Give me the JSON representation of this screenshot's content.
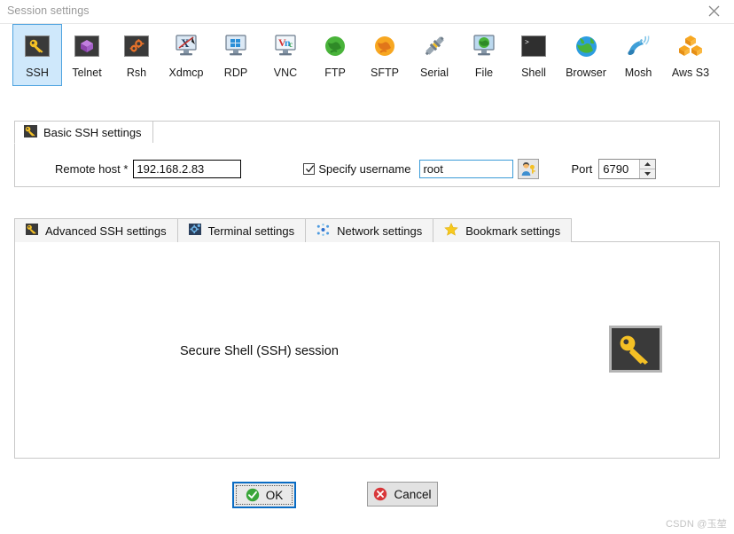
{
  "window": {
    "title": "Session settings",
    "close_icon": "close-icon"
  },
  "protocols": [
    {
      "label": "SSH",
      "icon": "ssh-key-icon",
      "selected": true
    },
    {
      "label": "Telnet",
      "icon": "telnet-cube-icon",
      "selected": false
    },
    {
      "label": "Rsh",
      "icon": "rsh-gears-icon",
      "selected": false
    },
    {
      "label": "Xdmcp",
      "icon": "xdmcp-x-monitor-icon",
      "selected": false
    },
    {
      "label": "RDP",
      "icon": "rdp-windows-monitor-icon",
      "selected": false
    },
    {
      "label": "VNC",
      "icon": "vnc-monitor-icon",
      "selected": false
    },
    {
      "label": "FTP",
      "icon": "ftp-green-globe-icon",
      "selected": false
    },
    {
      "label": "SFTP",
      "icon": "sftp-orange-globe-icon",
      "selected": false
    },
    {
      "label": "Serial",
      "icon": "serial-plug-icon",
      "selected": false
    },
    {
      "label": "File",
      "icon": "file-globe-monitor-icon",
      "selected": false
    },
    {
      "label": "Shell",
      "icon": "shell-prompt-icon",
      "selected": false
    },
    {
      "label": "Browser",
      "icon": "browser-globe-icon",
      "selected": false
    },
    {
      "label": "Mosh",
      "icon": "mosh-satellite-icon",
      "selected": false
    },
    {
      "label": "Aws S3",
      "icon": "aws-s3-cubes-icon",
      "selected": false
    }
  ],
  "basic_settings": {
    "group_label": "Basic SSH settings",
    "group_icon": "ssh-key-icon",
    "remote_host_label": "Remote host *",
    "remote_host_value": "192.168.2.83",
    "specify_username_label": "Specify username",
    "specify_username_checked": true,
    "username_value": "root",
    "username_picker_icon": "user-key-icon",
    "port_label": "Port",
    "port_value": "6790",
    "spinner_up_icon": "spinner-up-icon",
    "spinner_down_icon": "spinner-down-icon"
  },
  "settings_tabs": [
    {
      "label": "Advanced SSH settings",
      "icon": "ssh-key-icon"
    },
    {
      "label": "Terminal settings",
      "icon": "terminal-gear-icon"
    },
    {
      "label": "Network settings",
      "icon": "network-nodes-icon"
    },
    {
      "label": "Bookmark settings",
      "icon": "star-icon"
    }
  ],
  "content": {
    "session_description": "Secure Shell (SSH) session",
    "session_icon": "ssh-key-large-icon"
  },
  "buttons": {
    "ok_label": "OK",
    "ok_icon": "check-circle-icon",
    "cancel_label": "Cancel",
    "cancel_icon": "cancel-circle-icon"
  },
  "watermark": "CSDN @玉堃",
  "colors": {
    "accent_blue": "#0a6cc4",
    "selected_tab_bg": "#cfe8fb",
    "selected_tab_border": "#4ea3e0",
    "key_yellow": "#f4c025",
    "ok_green": "#3aa63a",
    "cancel_red": "#d8373a"
  }
}
